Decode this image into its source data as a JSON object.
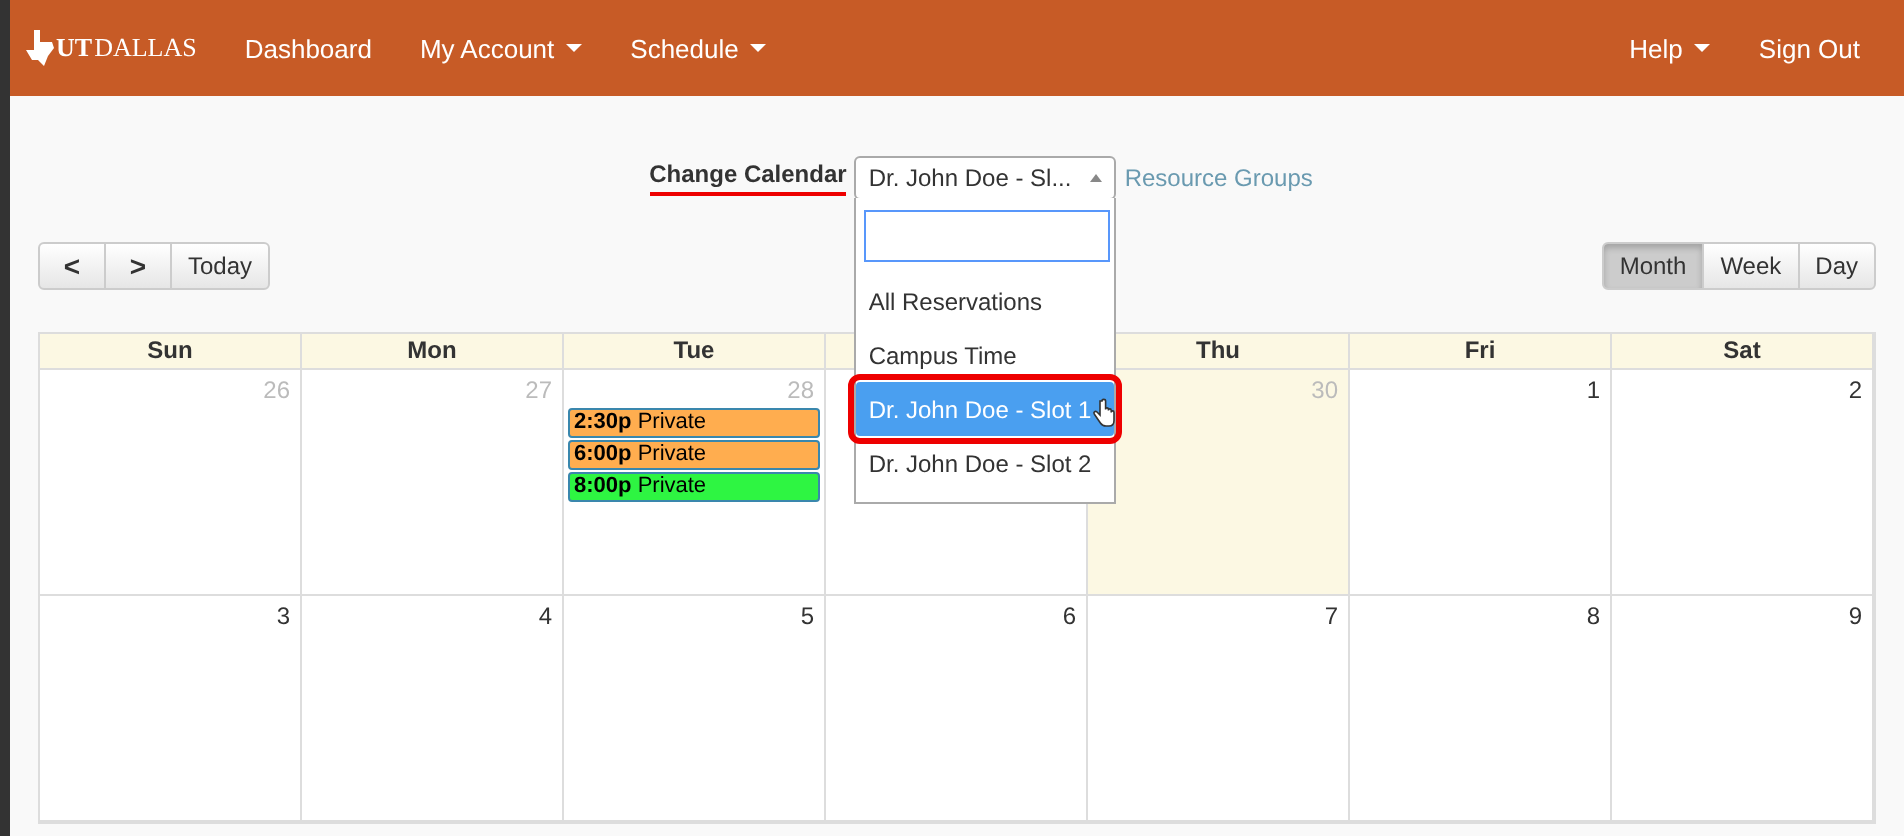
{
  "navbar": {
    "logo": {
      "mark": "UT",
      "text": "DALLAS"
    },
    "left_items": [
      {
        "label": "Dashboard",
        "has_menu": false
      },
      {
        "label": "My Account",
        "has_menu": true
      },
      {
        "label": "Schedule",
        "has_menu": true
      }
    ],
    "right_items": [
      {
        "label": "Help",
        "has_menu": true
      },
      {
        "label": "Sign Out",
        "has_menu": false
      }
    ]
  },
  "calendar_picker": {
    "label": "Change Calendar",
    "value": "Dr. John Doe - Sl...",
    "expanded": true,
    "link": "Resource Groups",
    "options": [
      {
        "label": "All Reservations",
        "selected": false
      },
      {
        "label": "Campus Time",
        "selected": false
      },
      {
        "label": "Dr. John Doe - Slot 1",
        "selected": true
      },
      {
        "label": "Dr. John Doe - Slot 2",
        "selected": false
      }
    ]
  },
  "navigation": {
    "prev": "<",
    "next": ">",
    "today": "Today"
  },
  "views": [
    {
      "label": "Month",
      "selected": true
    },
    {
      "label": "Week",
      "selected": false
    },
    {
      "label": "Day",
      "selected": false
    }
  ],
  "calendar": {
    "weekdays": [
      {
        "label": "Sun",
        "covered": false
      },
      {
        "label": "Mon",
        "covered": false
      },
      {
        "label": "Tue",
        "covered": false
      },
      {
        "covered": true
      },
      {
        "label": "Thu",
        "covered": false
      },
      {
        "label": "Fri",
        "covered": false
      },
      {
        "label": "Sat",
        "covered": false
      }
    ],
    "weeks": [
      {
        "days": [
          {
            "number": "26",
            "other_month": true,
            "today": false
          },
          {
            "number": "27",
            "other_month": true,
            "today": false
          },
          {
            "number": "28",
            "other_month": true,
            "today": false,
            "events": [
              {
                "time": "2:30p",
                "title": "Private",
                "color": "#ffad4f"
              },
              {
                "time": "6:00p",
                "title": "Private",
                "color": "#ffad4f"
              },
              {
                "time": "8:00p",
                "title": "Private",
                "color": "#2ef542"
              }
            ]
          },
          {
            "other_month": true,
            "today": false
          },
          {
            "number": "30",
            "other_month": true,
            "today": true
          },
          {
            "number": "1",
            "other_month": false,
            "today": false
          },
          {
            "number": "2",
            "other_month": false,
            "today": false
          }
        ]
      },
      {
        "days": [
          {
            "number": "3",
            "other_month": false,
            "today": false
          },
          {
            "number": "4",
            "other_month": false,
            "today": false
          },
          {
            "number": "5",
            "other_month": false,
            "today": false
          },
          {
            "number": "6",
            "other_month": false,
            "today": false
          },
          {
            "number": "7",
            "other_month": false,
            "today": false
          },
          {
            "number": "8",
            "other_month": false,
            "today": false
          },
          {
            "number": "9",
            "other_month": false,
            "today": false
          }
        ]
      }
    ]
  }
}
